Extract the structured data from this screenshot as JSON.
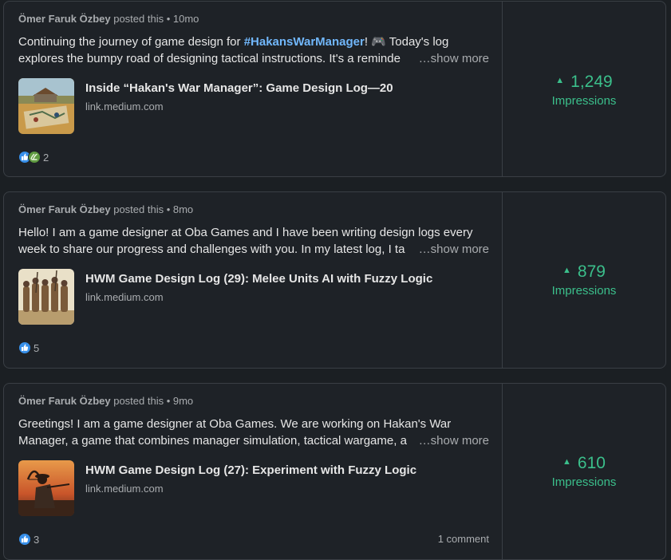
{
  "posts": [
    {
      "author": "Ömer Faruk Özbey",
      "posted_text": " posted this • 10mo",
      "line1_pre": "Continuing the journey of game design for ",
      "hashtag": "#HakansWarManager",
      "line1_post": "! 🎮 Today's log",
      "line2": "explores the bumpy road of designing tactical instructions. It's a reminde",
      "show_more": "…show more",
      "link_title": "Inside “Hakan's War Manager”: Game Design Log—20",
      "link_domain": "link.medium.com",
      "reaction_count": "2",
      "impressions_value": "1,249",
      "impressions_label": "Impressions"
    },
    {
      "author": "Ömer Faruk Özbey",
      "posted_text": " posted this • 8mo",
      "line1": "Hello! I am a game designer at Oba Games and I have been writing design logs every",
      "line2": "week to share our progress and challenges with you. In my latest log, I ta",
      "show_more": "…show more",
      "link_title": "HWM Game Design Log (29): Melee Units AI with Fuzzy Logic",
      "link_domain": "link.medium.com",
      "reaction_count": "5",
      "impressions_value": "879",
      "impressions_label": "Impressions"
    },
    {
      "author": "Ömer Faruk Özbey",
      "posted_text": " posted this • 9mo",
      "line1": "Greetings! I am a game designer at Oba Games. We are working on Hakan's War",
      "line2": "Manager, a game that combines manager simulation, tactical wargame, a",
      "show_more": "…show more",
      "link_title": "HWM Game Design Log (27): Experiment with Fuzzy Logic",
      "link_domain": "link.medium.com",
      "reaction_count": "3",
      "comments": "1 comment",
      "impressions_value": "610",
      "impressions_label": "Impressions"
    }
  ],
  "colors": {
    "accent_green": "#3bbf8b",
    "hashtag_blue": "#71b7fb",
    "like_blue": "#378fe9",
    "support_green": "#5f9b41"
  },
  "icons": {
    "like": "thumbs-up-icon",
    "support": "support-hands-icon",
    "trend": "triangle-up-icon"
  }
}
